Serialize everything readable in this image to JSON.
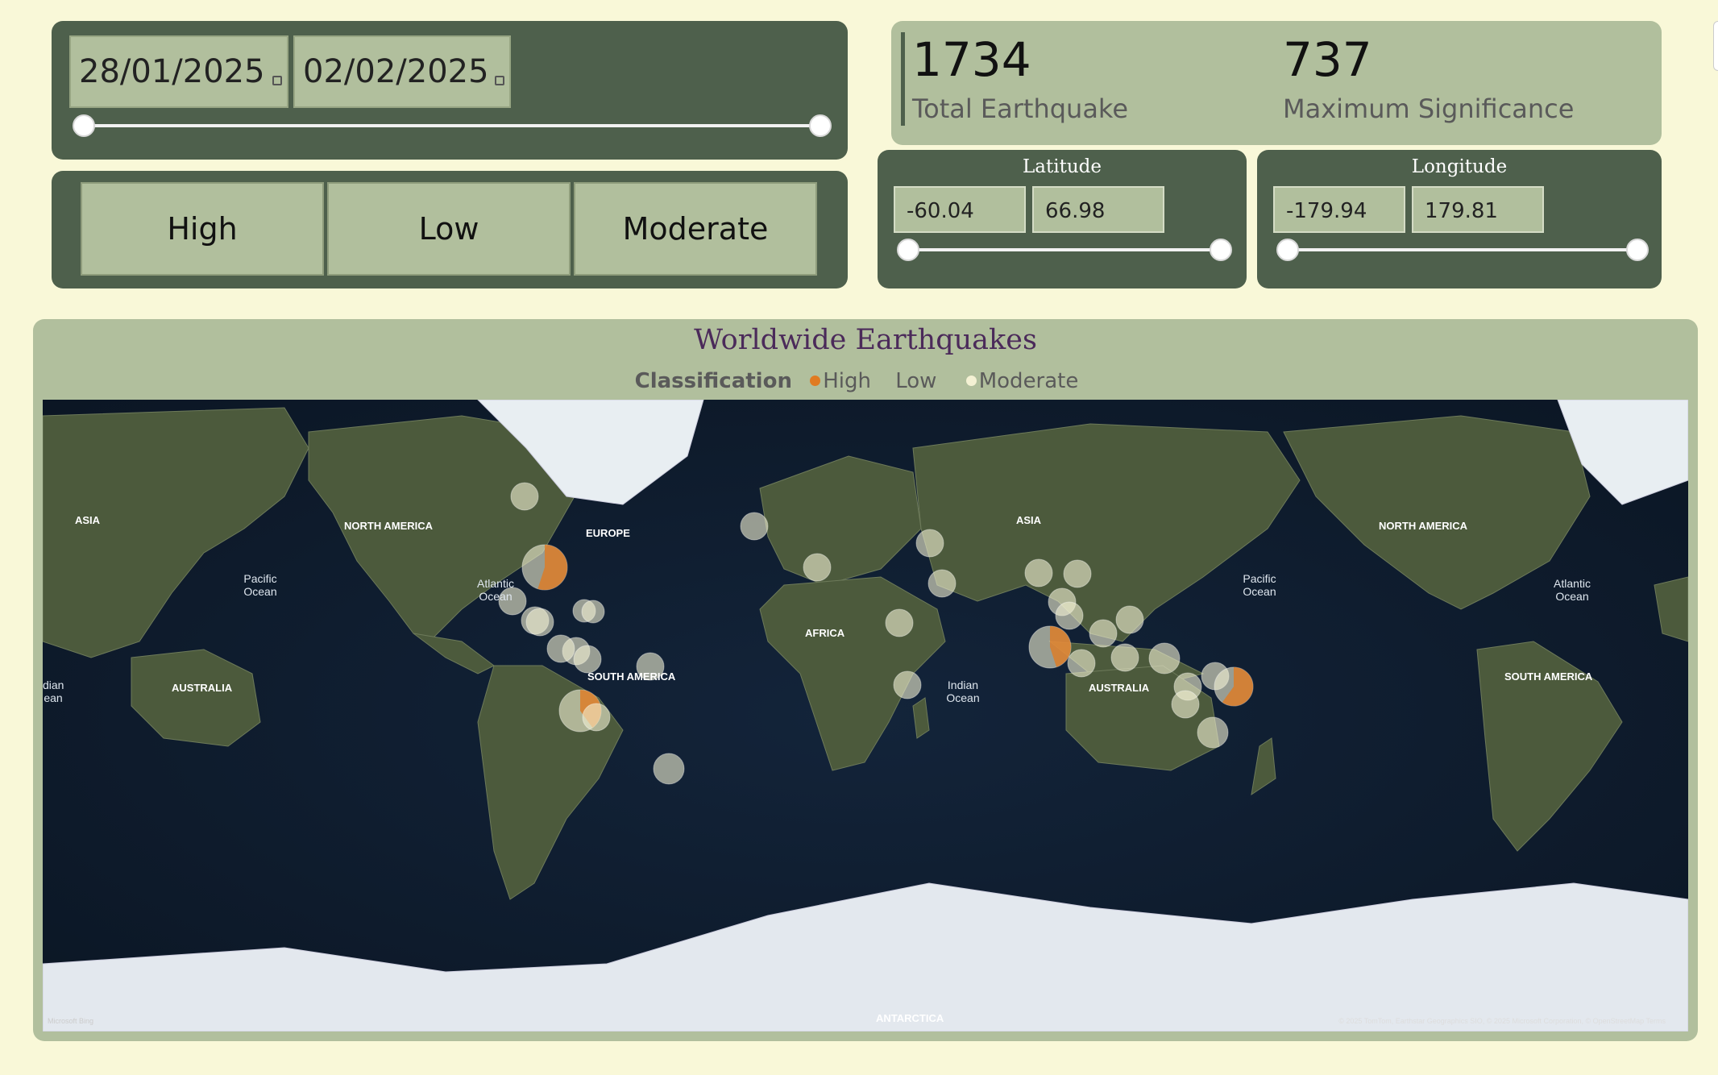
{
  "date_slicer": {
    "start": "28/01/2025",
    "end": "02/02/2025"
  },
  "classification_buttons": [
    "High",
    "Low",
    "Moderate"
  ],
  "kpis": {
    "total_value": "1734",
    "total_label": "Total Earthquake",
    "max_value": "737",
    "max_label": "Maximum Significance"
  },
  "latitude": {
    "title": "Latitude",
    "min": "-60.04",
    "max": "66.98"
  },
  "longitude": {
    "title": "Longitude",
    "min": "-179.94",
    "max": "179.81"
  },
  "map": {
    "title": "Worldwide Earthquakes",
    "legend_title": "Classification",
    "legend_items": [
      {
        "label": "High",
        "color": "#e07b22"
      },
      {
        "label": "Low",
        "color": ""
      },
      {
        "label": "Moderate",
        "color": "#f4f1d4"
      }
    ],
    "labels": {
      "asia_left": "ASIA",
      "north_america": "NORTH AMERICA",
      "europe": "EUROPE",
      "asia": "ASIA",
      "north_america_right": "NORTH AMERICA",
      "pacific": "Pacific Ocean",
      "atlantic": "Atlantic Ocean",
      "pacific_right": "Pacific Ocean",
      "atlantic_right": "Atlantic Ocean",
      "africa": "AFRICA",
      "indian": "Indian Ocean",
      "indian_left": "dian ean",
      "australia_left": "AUSTRALIA",
      "south_america": "SOUTH AMERICA",
      "australia": "AUSTRALIA",
      "south_america_right": "SOUTH AMERICA",
      "antarctica": "ANTARCTICA"
    },
    "copyright": "© 2025 TomTom, Earthstar Geographics SIO, © 2025 Microsoft Corporation, © OpenStreetMap  Terms",
    "bing": "Microsoft Bing"
  },
  "colors": {
    "background": "#f9f8d8",
    "panel_dark": "#4e604c",
    "panel_light": "#b1bf9d",
    "high": "#e07b22",
    "moderate": "#f4f1d4",
    "title": "#4b2a5a"
  }
}
